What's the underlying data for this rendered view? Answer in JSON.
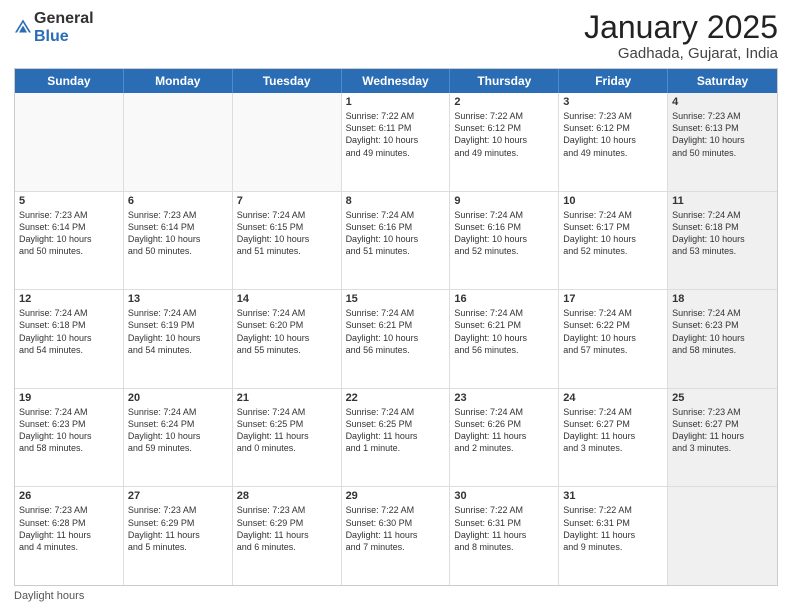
{
  "header": {
    "logo_general": "General",
    "logo_blue": "Blue",
    "title": "January 2025",
    "location": "Gadhada, Gujarat, India"
  },
  "weekdays": [
    "Sunday",
    "Monday",
    "Tuesday",
    "Wednesday",
    "Thursday",
    "Friday",
    "Saturday"
  ],
  "footer": "Daylight hours",
  "rows": [
    [
      {
        "day": "",
        "info": "",
        "empty": true
      },
      {
        "day": "",
        "info": "",
        "empty": true
      },
      {
        "day": "",
        "info": "",
        "empty": true
      },
      {
        "day": "1",
        "info": "Sunrise: 7:22 AM\nSunset: 6:11 PM\nDaylight: 10 hours\nand 49 minutes.",
        "empty": false
      },
      {
        "day": "2",
        "info": "Sunrise: 7:22 AM\nSunset: 6:12 PM\nDaylight: 10 hours\nand 49 minutes.",
        "empty": false
      },
      {
        "day": "3",
        "info": "Sunrise: 7:23 AM\nSunset: 6:12 PM\nDaylight: 10 hours\nand 49 minutes.",
        "empty": false
      },
      {
        "day": "4",
        "info": "Sunrise: 7:23 AM\nSunset: 6:13 PM\nDaylight: 10 hours\nand 50 minutes.",
        "empty": false,
        "shaded": true
      }
    ],
    [
      {
        "day": "5",
        "info": "Sunrise: 7:23 AM\nSunset: 6:14 PM\nDaylight: 10 hours\nand 50 minutes.",
        "empty": false
      },
      {
        "day": "6",
        "info": "Sunrise: 7:23 AM\nSunset: 6:14 PM\nDaylight: 10 hours\nand 50 minutes.",
        "empty": false
      },
      {
        "day": "7",
        "info": "Sunrise: 7:24 AM\nSunset: 6:15 PM\nDaylight: 10 hours\nand 51 minutes.",
        "empty": false
      },
      {
        "day": "8",
        "info": "Sunrise: 7:24 AM\nSunset: 6:16 PM\nDaylight: 10 hours\nand 51 minutes.",
        "empty": false
      },
      {
        "day": "9",
        "info": "Sunrise: 7:24 AM\nSunset: 6:16 PM\nDaylight: 10 hours\nand 52 minutes.",
        "empty": false
      },
      {
        "day": "10",
        "info": "Sunrise: 7:24 AM\nSunset: 6:17 PM\nDaylight: 10 hours\nand 52 minutes.",
        "empty": false
      },
      {
        "day": "11",
        "info": "Sunrise: 7:24 AM\nSunset: 6:18 PM\nDaylight: 10 hours\nand 53 minutes.",
        "empty": false,
        "shaded": true
      }
    ],
    [
      {
        "day": "12",
        "info": "Sunrise: 7:24 AM\nSunset: 6:18 PM\nDaylight: 10 hours\nand 54 minutes.",
        "empty": false
      },
      {
        "day": "13",
        "info": "Sunrise: 7:24 AM\nSunset: 6:19 PM\nDaylight: 10 hours\nand 54 minutes.",
        "empty": false
      },
      {
        "day": "14",
        "info": "Sunrise: 7:24 AM\nSunset: 6:20 PM\nDaylight: 10 hours\nand 55 minutes.",
        "empty": false
      },
      {
        "day": "15",
        "info": "Sunrise: 7:24 AM\nSunset: 6:21 PM\nDaylight: 10 hours\nand 56 minutes.",
        "empty": false
      },
      {
        "day": "16",
        "info": "Sunrise: 7:24 AM\nSunset: 6:21 PM\nDaylight: 10 hours\nand 56 minutes.",
        "empty": false
      },
      {
        "day": "17",
        "info": "Sunrise: 7:24 AM\nSunset: 6:22 PM\nDaylight: 10 hours\nand 57 minutes.",
        "empty": false
      },
      {
        "day": "18",
        "info": "Sunrise: 7:24 AM\nSunset: 6:23 PM\nDaylight: 10 hours\nand 58 minutes.",
        "empty": false,
        "shaded": true
      }
    ],
    [
      {
        "day": "19",
        "info": "Sunrise: 7:24 AM\nSunset: 6:23 PM\nDaylight: 10 hours\nand 58 minutes.",
        "empty": false
      },
      {
        "day": "20",
        "info": "Sunrise: 7:24 AM\nSunset: 6:24 PM\nDaylight: 10 hours\nand 59 minutes.",
        "empty": false
      },
      {
        "day": "21",
        "info": "Sunrise: 7:24 AM\nSunset: 6:25 PM\nDaylight: 11 hours\nand 0 minutes.",
        "empty": false
      },
      {
        "day": "22",
        "info": "Sunrise: 7:24 AM\nSunset: 6:25 PM\nDaylight: 11 hours\nand 1 minute.",
        "empty": false
      },
      {
        "day": "23",
        "info": "Sunrise: 7:24 AM\nSunset: 6:26 PM\nDaylight: 11 hours\nand 2 minutes.",
        "empty": false
      },
      {
        "day": "24",
        "info": "Sunrise: 7:24 AM\nSunset: 6:27 PM\nDaylight: 11 hours\nand 3 minutes.",
        "empty": false
      },
      {
        "day": "25",
        "info": "Sunrise: 7:23 AM\nSunset: 6:27 PM\nDaylight: 11 hours\nand 3 minutes.",
        "empty": false,
        "shaded": true
      }
    ],
    [
      {
        "day": "26",
        "info": "Sunrise: 7:23 AM\nSunset: 6:28 PM\nDaylight: 11 hours\nand 4 minutes.",
        "empty": false
      },
      {
        "day": "27",
        "info": "Sunrise: 7:23 AM\nSunset: 6:29 PM\nDaylight: 11 hours\nand 5 minutes.",
        "empty": false
      },
      {
        "day": "28",
        "info": "Sunrise: 7:23 AM\nSunset: 6:29 PM\nDaylight: 11 hours\nand 6 minutes.",
        "empty": false
      },
      {
        "day": "29",
        "info": "Sunrise: 7:22 AM\nSunset: 6:30 PM\nDaylight: 11 hours\nand 7 minutes.",
        "empty": false
      },
      {
        "day": "30",
        "info": "Sunrise: 7:22 AM\nSunset: 6:31 PM\nDaylight: 11 hours\nand 8 minutes.",
        "empty": false
      },
      {
        "day": "31",
        "info": "Sunrise: 7:22 AM\nSunset: 6:31 PM\nDaylight: 11 hours\nand 9 minutes.",
        "empty": false
      },
      {
        "day": "",
        "info": "",
        "empty": true,
        "shaded": true
      }
    ]
  ]
}
